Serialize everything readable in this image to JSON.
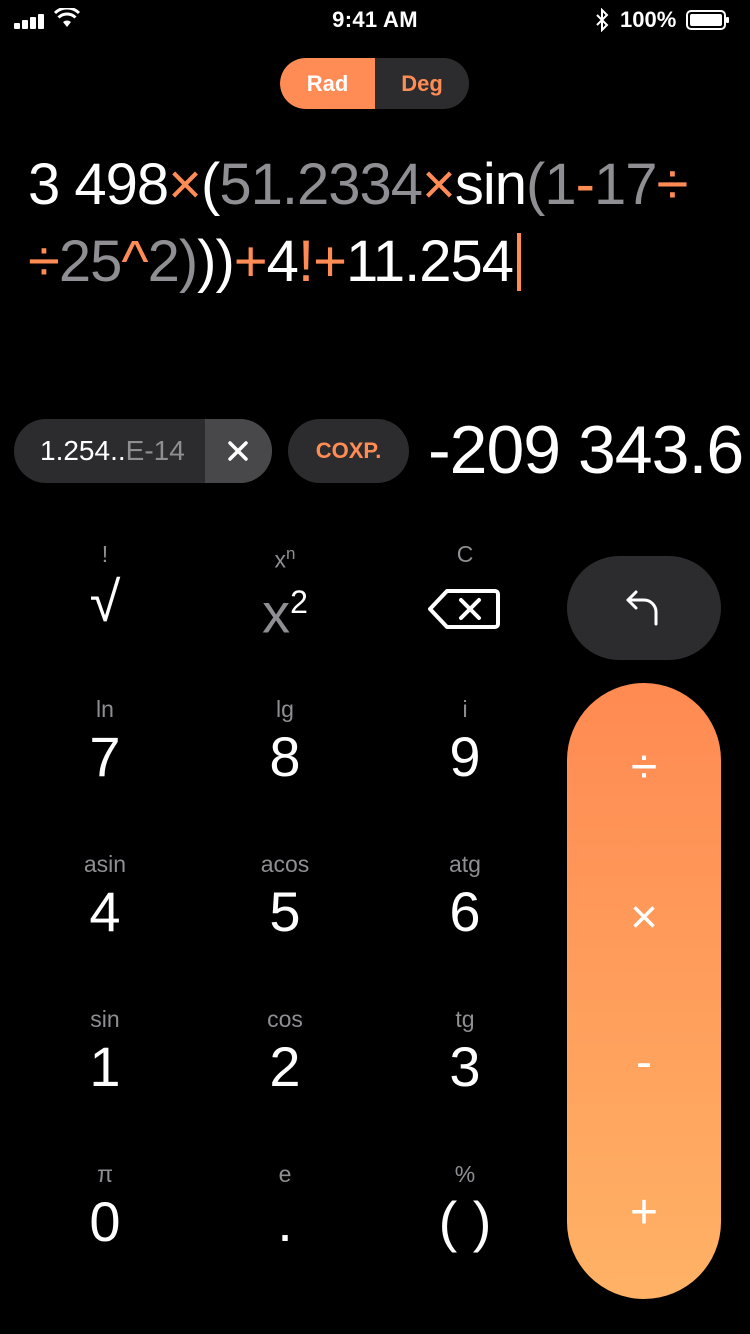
{
  "status_bar": {
    "time": "9:41 AM",
    "battery": "100%"
  },
  "mode": {
    "rad": "Rad",
    "deg": "Deg",
    "selected": "Rad"
  },
  "expression": {
    "line1": [
      {
        "text": "3 498",
        "color": "w"
      },
      {
        "text": "×",
        "color": "o"
      },
      {
        "text": "(",
        "color": "w"
      },
      {
        "text": "51.2334",
        "color": "g"
      },
      {
        "text": "×",
        "color": "o"
      },
      {
        "text": "sin",
        "color": "w"
      },
      {
        "text": "(",
        "color": "g"
      },
      {
        "text": "1",
        "color": "g"
      },
      {
        "text": "-",
        "color": "o"
      },
      {
        "text": "17",
        "color": "g"
      },
      {
        "text": "÷",
        "color": "o"
      }
    ],
    "line2": [
      {
        "text": "÷",
        "color": "o"
      },
      {
        "text": "25",
        "color": "g"
      },
      {
        "text": "^",
        "color": "o"
      },
      {
        "text": "2)",
        "color": "g"
      },
      {
        "text": "))",
        "color": "w"
      },
      {
        "text": "+",
        "color": "o"
      },
      {
        "text": "4",
        "color": "w"
      },
      {
        "text": "!",
        "color": "o"
      },
      {
        "text": "+",
        "color": "o"
      },
      {
        "text": "11.254",
        "color": "w"
      }
    ]
  },
  "memory": {
    "value_main": "1.254..",
    "value_dim": "E-14"
  },
  "coxp_label": "COXP.",
  "result": "-209 343.6",
  "keys": {
    "sqrt": {
      "sub": "!",
      "main": "√"
    },
    "square": {
      "sub": "x",
      "sub_sup": "n",
      "main": "x",
      "main_sup": "2"
    },
    "backspace": {
      "sub": "C"
    },
    "k7": {
      "sub": "ln",
      "main": "7"
    },
    "k8": {
      "sub": "lg",
      "main": "8"
    },
    "k9": {
      "sub": "i",
      "main": "9"
    },
    "k4": {
      "sub": "asin",
      "main": "4"
    },
    "k5": {
      "sub": "acos",
      "main": "5"
    },
    "k6": {
      "sub": "atg",
      "main": "6"
    },
    "k1": {
      "sub": "sin",
      "main": "1"
    },
    "k2": {
      "sub": "cos",
      "main": "2"
    },
    "k3": {
      "sub": "tg",
      "main": "3"
    },
    "k0": {
      "sub": "π",
      "main": "0"
    },
    "kdot": {
      "sub": "e",
      "main": "."
    },
    "kparen": {
      "sub": "%",
      "main": "( )"
    }
  },
  "operators": {
    "divide": "÷",
    "multiply": "×",
    "minus": "-",
    "plus": "+"
  },
  "colors": {
    "accent": "#ff8c55",
    "key_bg": "#2c2c2e",
    "muted": "#8e8e93"
  },
  "icons": {
    "undo": "undo-arrow-icon",
    "backspace": "backspace-icon",
    "clear": "close-icon",
    "bluetooth": "bluetooth-icon"
  }
}
